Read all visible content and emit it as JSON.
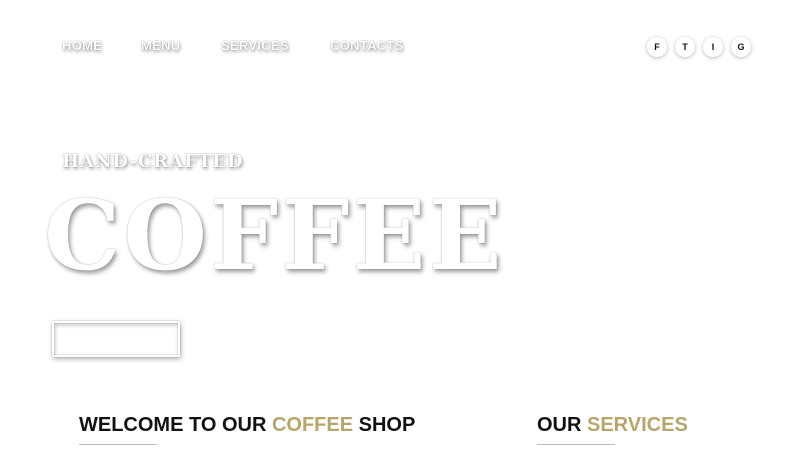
{
  "nav": {
    "items": [
      {
        "label": "Home"
      },
      {
        "label": "Menu"
      },
      {
        "label": "Services"
      },
      {
        "label": "Contacts"
      }
    ]
  },
  "social": {
    "items": [
      {
        "label": "F",
        "icon": "facebook-icon"
      },
      {
        "label": "T",
        "icon": "twitter-icon"
      },
      {
        "label": "I",
        "icon": "instagram-icon"
      },
      {
        "label": "G",
        "icon": "google-icon"
      }
    ]
  },
  "hero": {
    "kicker": "Hand-Crafted",
    "title": "Coffee",
    "button_label": ""
  },
  "welcome": {
    "prefix": "Welcome to our ",
    "accent": "Coffee",
    "suffix": " Shop"
  },
  "services": {
    "prefix": "Our ",
    "accent": "Services"
  },
  "colors": {
    "background": "#ffffff",
    "accent": "#b7a66a",
    "heading": "#111111"
  }
}
